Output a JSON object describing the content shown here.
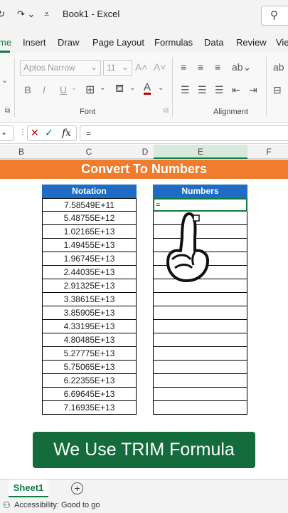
{
  "window": {
    "file_title": "Book1 - Excel",
    "search_icon": "search-icon"
  },
  "tabs": [
    "me",
    "Insert",
    "Draw",
    "Page Layout",
    "Formulas",
    "Data",
    "Review",
    "Vie"
  ],
  "ribbon": {
    "font_name": "Aptos Narrow",
    "font_size": "11",
    "font_group_label": "Font",
    "alignment_group_label": "Alignment"
  },
  "formula_bar": {
    "fx_label": "fx",
    "content": "="
  },
  "columns": [
    "B",
    "C",
    "D",
    "E",
    "F"
  ],
  "banner": "Convert To Numbers",
  "notation_table": {
    "header": "Notation",
    "values": [
      "7.58549E+11",
      "5.48755E+12",
      "1.02165E+13",
      "1.49455E+13",
      "1.96745E+13",
      "2.44035E+13",
      "2.91325E+13",
      "3.38615E+13",
      "3.85905E+13",
      "4.33195E+13",
      "4.80485E+13",
      "5.27775E+13",
      "5.75065E+13",
      "6.22355E+13",
      "6.69645E+13",
      "7.16935E+13"
    ]
  },
  "numbers_table": {
    "header": "Numbers",
    "first_cell": "="
  },
  "button": {
    "label": "We Use TRIM Formula"
  },
  "sheets": {
    "active": "Sheet1"
  },
  "status": {
    "accessibility": "Accessibility: Good to go"
  }
}
